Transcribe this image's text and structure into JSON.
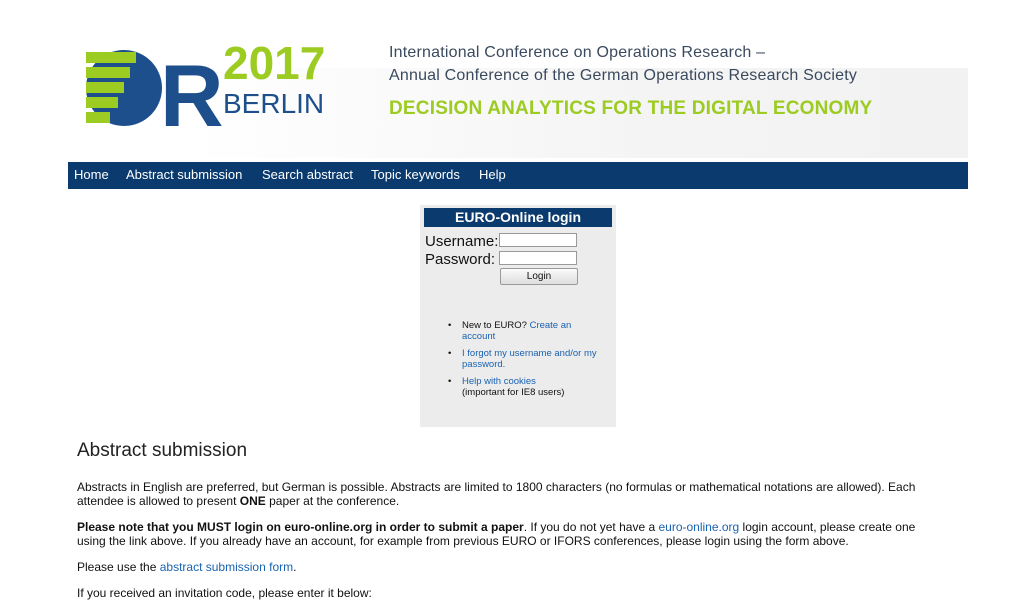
{
  "header": {
    "logo_or": "OR",
    "logo_year": "2017",
    "logo_city": "BERLIN",
    "conf_line1": "International Conference on Operations Research –",
    "conf_line2": "Annual Conference of the German Operations Research Society",
    "tagline": "DECISION ANALYTICS FOR THE DIGITAL ECONOMY",
    "colors": {
      "navy": "#0b3b6e",
      "green": "#9ccb21",
      "blue_logo": "#1d4f8c"
    }
  },
  "nav": {
    "items": [
      "Home",
      "Abstract submission",
      "Search abstract",
      "Topic keywords",
      "Help"
    ]
  },
  "login": {
    "title": "EURO-Online login",
    "username_label": "Username:",
    "password_label": "Password:",
    "button_label": "Login",
    "new_prefix": "New to EURO?",
    "create_link": "Create an account",
    "forgot_link": "I forgot my username and/or my password.",
    "cookies_link": "Help with cookies",
    "cookies_note": "(important for IE8 users)"
  },
  "content": {
    "heading": "Abstract submission",
    "p1_text": "Abstracts in English are preferred, but German is possible. Abstracts are limited to 1800 characters (no formulas or mathematical notations are allowed). Each attendee is allowed to present ",
    "p1_bold": "ONE",
    "p1_tail": " paper at the conference.",
    "p2_bold": "Please note that you MUST login on euro-online.org in order to submit a paper",
    "p2_text": ". If you do not yet have a ",
    "p2_link": "euro-online.org",
    "p2_tail": " login account, please create one using the link above. If you already have an account, for example from previous EURO or IFORS conferences, please login using the form above.",
    "p3_text": "Please use the ",
    "p3_link": "abstract submission form",
    "p3_tail": ".",
    "p4_text": "If you received an invitation code, please enter it below:"
  }
}
